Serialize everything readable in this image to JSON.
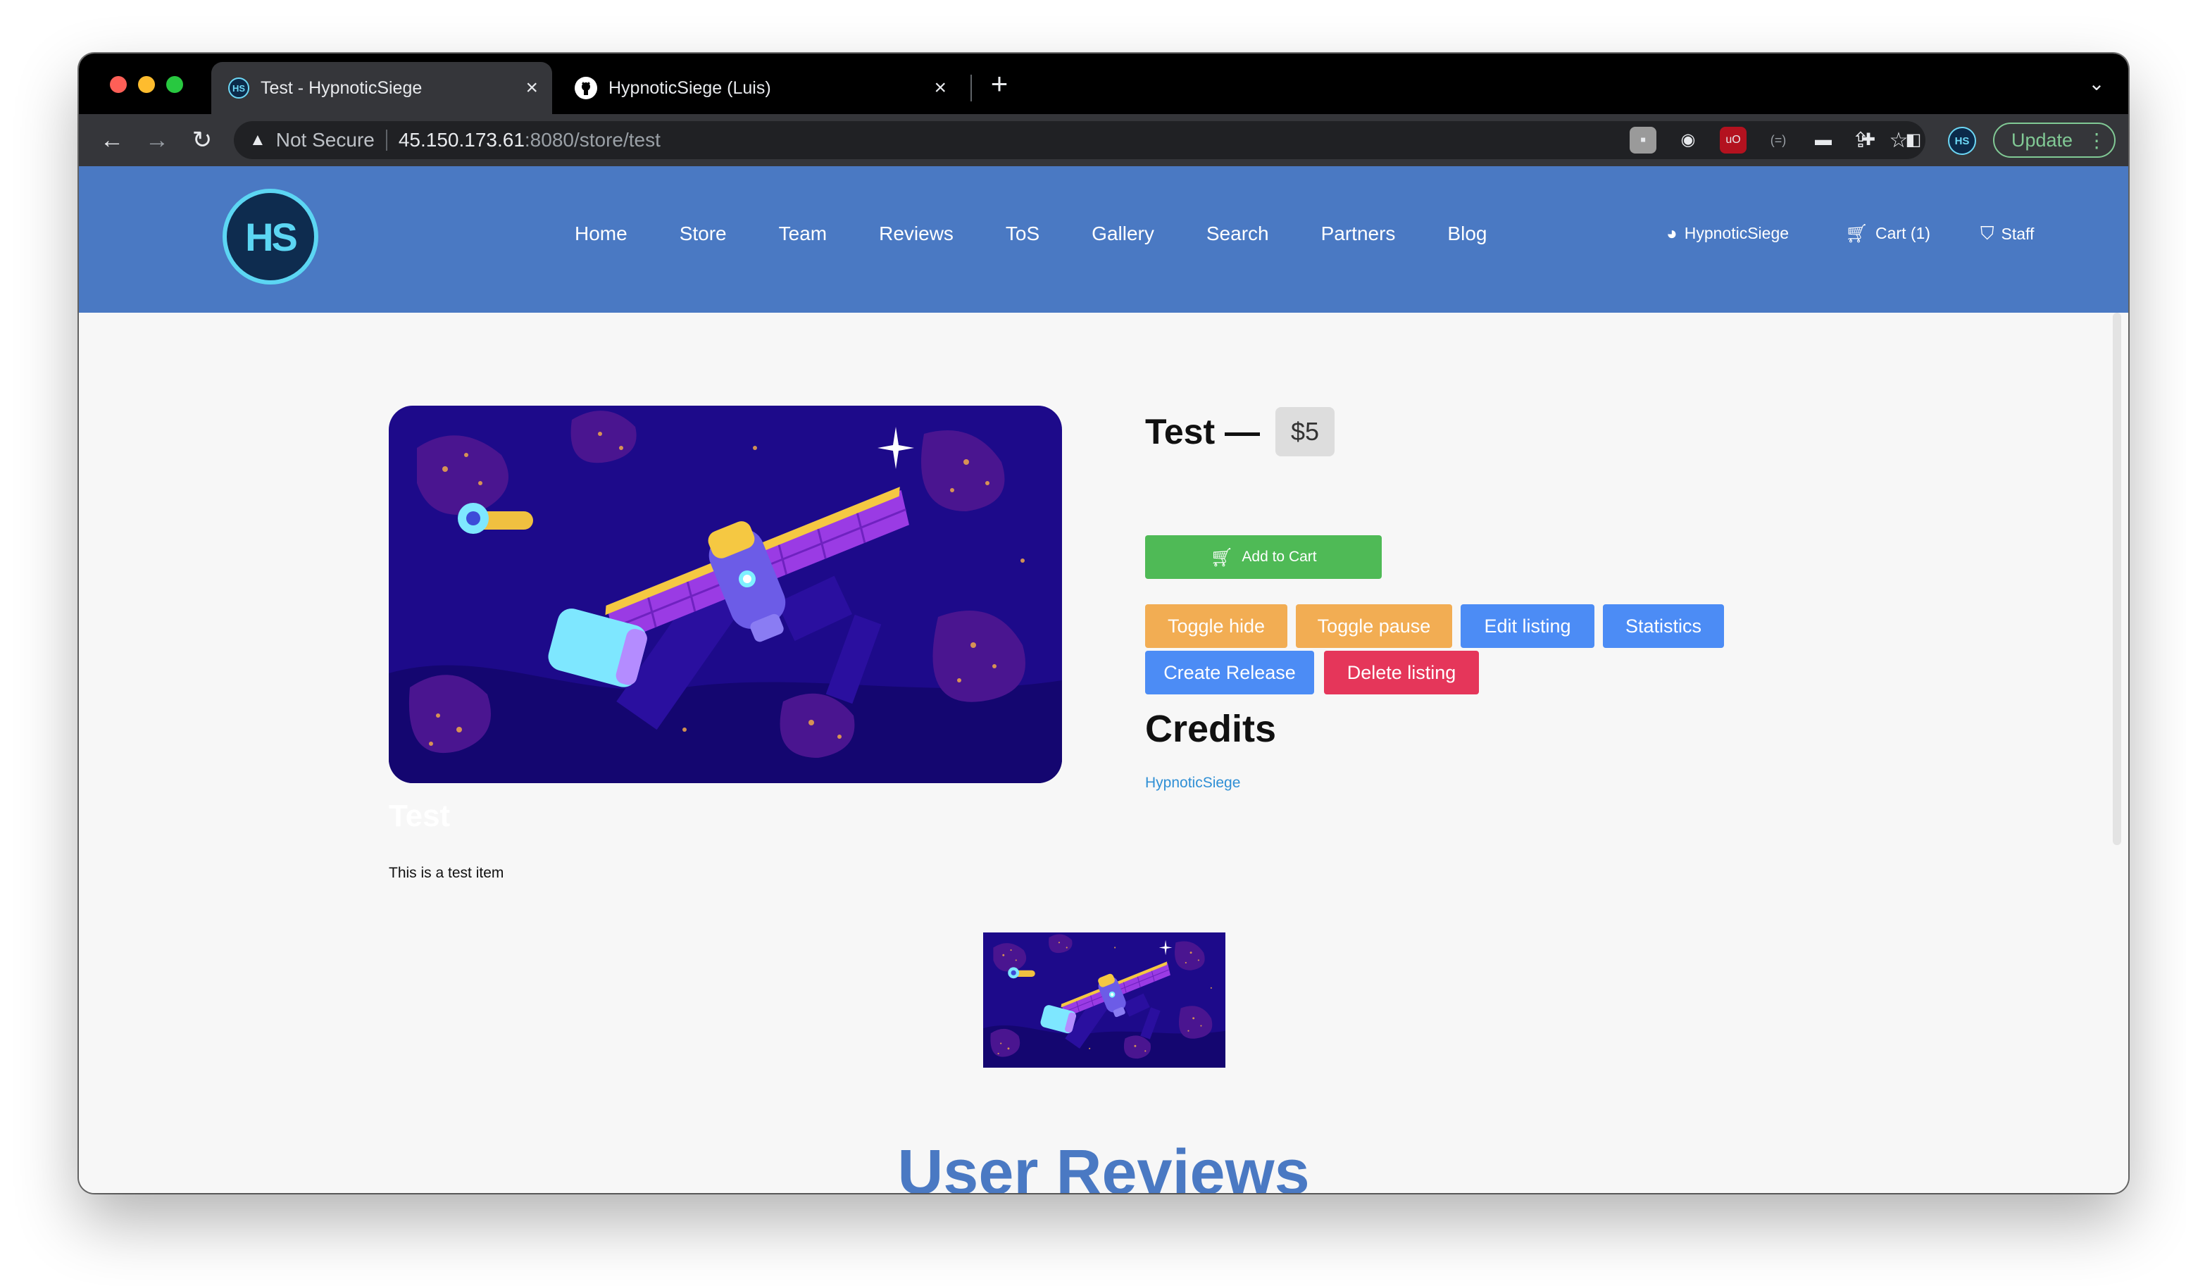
{
  "browser": {
    "tabs": [
      {
        "title": "Test - HypnoticSiege",
        "active": true
      },
      {
        "title": "HypnoticSiege (Luis)",
        "active": false
      }
    ],
    "new_tab_label": "+",
    "address": {
      "security_label": "Not Secure",
      "host": "45.150.173.61",
      "rest": ":8080/store/test"
    },
    "profile_initials": "HS",
    "update_label": "Update"
  },
  "site": {
    "logo_text": "HS",
    "nav": [
      "Home",
      "Store",
      "Team",
      "Reviews",
      "ToS",
      "Gallery",
      "Search",
      "Partners",
      "Blog"
    ],
    "user_label": "HypnoticSiege",
    "cart_label": "Cart (1)",
    "staff_label": "Staff",
    "accent_color": "#4a79c3"
  },
  "product": {
    "title": "Test —",
    "price": "$5",
    "add_to_cart": "Add to Cart",
    "admin_buttons": {
      "toggle_hide": "Toggle hide",
      "toggle_pause": "Toggle pause",
      "edit_listing": "Edit listing",
      "statistics": "Statistics",
      "create_release": "Create Release",
      "delete_listing": "Delete listing"
    },
    "credits_heading": "Credits",
    "credit_name": "HypnoticSiege",
    "image_title": "Test",
    "description": "This is a test item"
  },
  "reviews": {
    "heading": "User Reviews"
  }
}
